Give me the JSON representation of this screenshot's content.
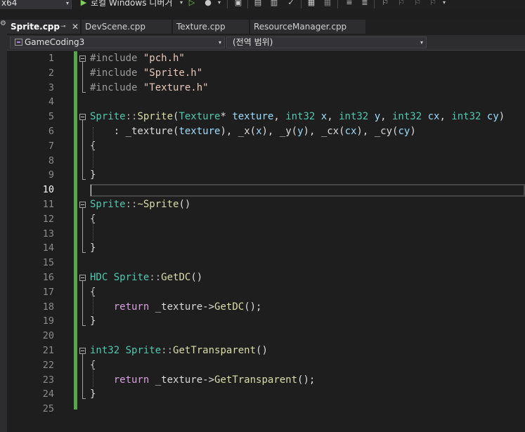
{
  "toolbar": {
    "platform": "x64",
    "debugger_label": "로컬 Windows 디버거",
    "chevron": "▾",
    "icons": [
      "play-icon",
      "play-outline-icon",
      "fire-icon",
      "browser-link-icon",
      "find-icon",
      "spellcheck-icon",
      "format-icon",
      "comment-icon",
      "bookmark-icon"
    ]
  },
  "tabs": [
    {
      "label": "Sprite.cpp",
      "active": true,
      "pin": "⊸",
      "close": "✕"
    },
    {
      "label": "DevScene.cpp",
      "active": false
    },
    {
      "label": "Texture.cpp",
      "active": false
    },
    {
      "label": "ResourceManager.cpp",
      "active": false
    }
  ],
  "navbar": {
    "project": "GameCoding3",
    "scope": "(전역 범위)"
  },
  "editor": {
    "current_line": 10,
    "line_numbers": [
      "1",
      "2",
      "3",
      "4",
      "5",
      "6",
      "7",
      "8",
      "9",
      "10",
      "11",
      "12",
      "13",
      "14",
      "15",
      "16",
      "17",
      "18",
      "19",
      "20",
      "21",
      "22",
      "23",
      "24",
      "25"
    ],
    "lines": [
      [
        {
          "t": "#include ",
          "c": "pre"
        },
        {
          "t": "\"pch.h\"",
          "c": "str"
        }
      ],
      [
        {
          "t": "#include ",
          "c": "pre"
        },
        {
          "t": "\"Sprite.h\"",
          "c": "str"
        }
      ],
      [
        {
          "t": "#include ",
          "c": "pre"
        },
        {
          "t": "\"Texture.h\"",
          "c": "str"
        }
      ],
      [],
      [
        {
          "t": "Sprite",
          "c": "cls"
        },
        {
          "t": "::",
          "c": "punc"
        },
        {
          "t": "Sprite",
          "c": "fn"
        },
        {
          "t": "(",
          "c": ""
        },
        {
          "t": "Texture",
          "c": "cls"
        },
        {
          "t": "* ",
          "c": ""
        },
        {
          "t": "texture",
          "c": "par"
        },
        {
          "t": ", ",
          "c": ""
        },
        {
          "t": "int32",
          "c": "cls"
        },
        {
          "t": " ",
          "c": ""
        },
        {
          "t": "x",
          "c": "par"
        },
        {
          "t": ", ",
          "c": ""
        },
        {
          "t": "int32",
          "c": "cls"
        },
        {
          "t": " ",
          "c": ""
        },
        {
          "t": "y",
          "c": "par"
        },
        {
          "t": ", ",
          "c": ""
        },
        {
          "t": "int32",
          "c": "cls"
        },
        {
          "t": " ",
          "c": ""
        },
        {
          "t": "cx",
          "c": "par"
        },
        {
          "t": ", ",
          "c": ""
        },
        {
          "t": "int32",
          "c": "cls"
        },
        {
          "t": " ",
          "c": ""
        },
        {
          "t": "cy",
          "c": "par"
        },
        {
          "t": ")",
          "c": ""
        }
      ],
      [
        {
          "t": "    : ",
          "c": ""
        },
        {
          "t": "_texture",
          "c": "mem"
        },
        {
          "t": "(",
          "c": ""
        },
        {
          "t": "texture",
          "c": "par"
        },
        {
          "t": "), ",
          "c": ""
        },
        {
          "t": "_x",
          "c": "mem"
        },
        {
          "t": "(",
          "c": ""
        },
        {
          "t": "x",
          "c": "par"
        },
        {
          "t": "), ",
          "c": ""
        },
        {
          "t": "_y",
          "c": "mem"
        },
        {
          "t": "(",
          "c": ""
        },
        {
          "t": "y",
          "c": "par"
        },
        {
          "t": "), ",
          "c": ""
        },
        {
          "t": "_cx",
          "c": "mem"
        },
        {
          "t": "(",
          "c": ""
        },
        {
          "t": "cx",
          "c": "par"
        },
        {
          "t": "), ",
          "c": ""
        },
        {
          "t": "_cy",
          "c": "mem"
        },
        {
          "t": "(",
          "c": ""
        },
        {
          "t": "cy",
          "c": "par"
        },
        {
          "t": ")",
          "c": ""
        }
      ],
      [
        {
          "t": "{",
          "c": ""
        }
      ],
      [],
      [
        {
          "t": "}",
          "c": ""
        }
      ],
      [],
      [
        {
          "t": "Sprite",
          "c": "cls"
        },
        {
          "t": "::",
          "c": "punc"
        },
        {
          "t": "~Sprite",
          "c": "fn"
        },
        {
          "t": "()",
          "c": ""
        }
      ],
      [
        {
          "t": "{",
          "c": ""
        }
      ],
      [],
      [
        {
          "t": "}",
          "c": ""
        }
      ],
      [],
      [
        {
          "t": "HDC",
          "c": "cls"
        },
        {
          "t": " ",
          "c": ""
        },
        {
          "t": "Sprite",
          "c": "cls"
        },
        {
          "t": "::",
          "c": "punc"
        },
        {
          "t": "GetDC",
          "c": "fn"
        },
        {
          "t": "()",
          "c": ""
        }
      ],
      [
        {
          "t": "{",
          "c": ""
        }
      ],
      [
        {
          "t": "    ",
          "c": ""
        },
        {
          "t": "return",
          "c": "ctl"
        },
        {
          "t": " ",
          "c": ""
        },
        {
          "t": "_texture",
          "c": "mem"
        },
        {
          "t": "->",
          "c": ""
        },
        {
          "t": "GetDC",
          "c": "fn"
        },
        {
          "t": "();",
          "c": ""
        }
      ],
      [
        {
          "t": "}",
          "c": ""
        }
      ],
      [],
      [
        {
          "t": "int32",
          "c": "cls"
        },
        {
          "t": " ",
          "c": ""
        },
        {
          "t": "Sprite",
          "c": "cls"
        },
        {
          "t": "::",
          "c": "punc"
        },
        {
          "t": "GetTransparent",
          "c": "fn"
        },
        {
          "t": "()",
          "c": ""
        }
      ],
      [
        {
          "t": "{",
          "c": ""
        }
      ],
      [
        {
          "t": "    ",
          "c": ""
        },
        {
          "t": "return",
          "c": "ctl"
        },
        {
          "t": " ",
          "c": ""
        },
        {
          "t": "_texture",
          "c": "mem"
        },
        {
          "t": "->",
          "c": ""
        },
        {
          "t": "GetTransparent",
          "c": "fn"
        },
        {
          "t": "();",
          "c": ""
        }
      ],
      [
        {
          "t": "}",
          "c": ""
        }
      ],
      []
    ]
  },
  "colors": {
    "background": "#1e1e1e",
    "change_bar": "#57a64a",
    "type": "#4ec9b0",
    "function": "#dcdcaa",
    "string": "#e8c9bb",
    "control_keyword": "#d8a0df"
  }
}
